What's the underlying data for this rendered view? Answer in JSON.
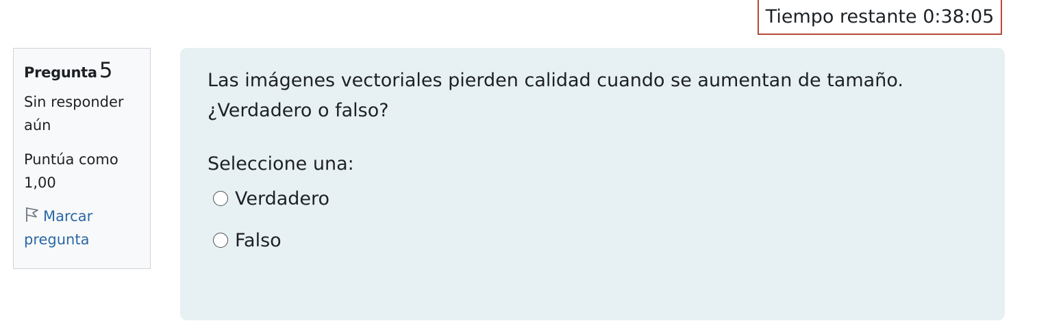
{
  "timer": {
    "label": "Tiempo restante 0:38:05"
  },
  "info": {
    "question_label": "Pregunta",
    "question_number": "5",
    "state_line1": "Sin responder",
    "state_line2": "aún",
    "grade_line1": "Puntúa como",
    "grade_line2": "1,00",
    "flag_line1": "Marcar",
    "flag_line2": "pregunta",
    "flag_icon": "flag-icon"
  },
  "question": {
    "text": "Las imágenes vectoriales pierden calidad cuando se aumentan de tamaño. ¿Verdadero o falso?",
    "prompt": "Seleccione una:",
    "options": [
      {
        "label": "Verdadero",
        "selected": false
      },
      {
        "label": "Falso",
        "selected": false
      }
    ]
  }
}
